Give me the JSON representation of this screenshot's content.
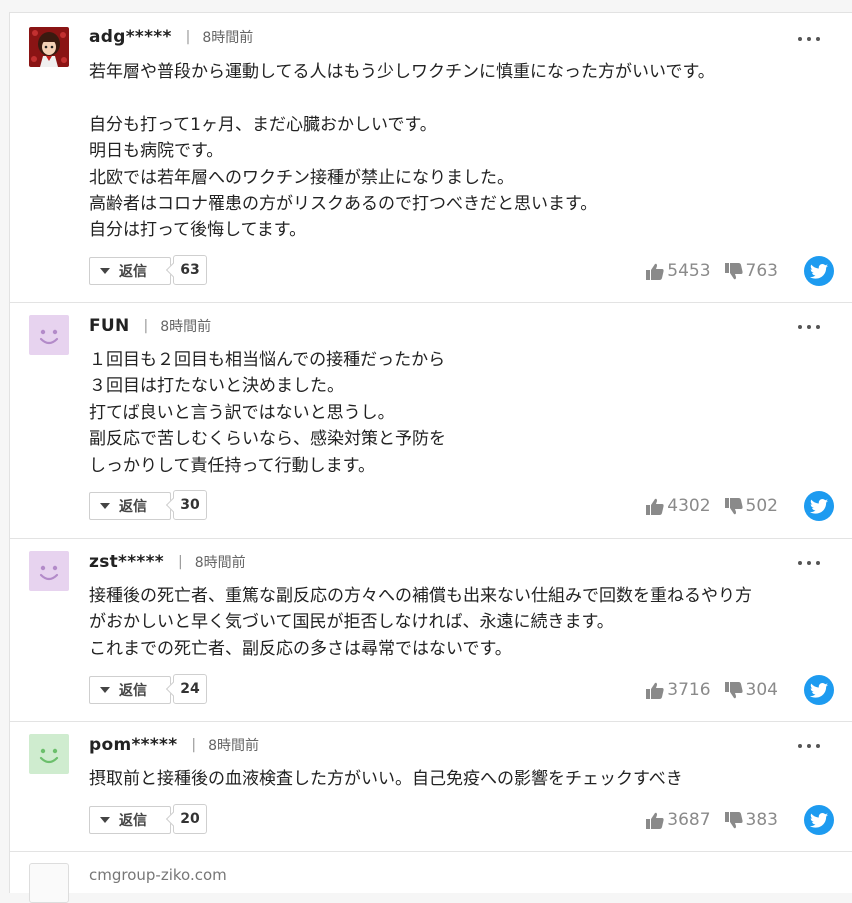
{
  "comments": [
    {
      "user": "adg*****",
      "separator": "|",
      "time": "8時間前",
      "avatar": "illustrated-avatar",
      "lines": [
        "若年層や普段から運動してる人はもう少しワクチンに慎重になった方がいいです。",
        "",
        "自分も打って1ヶ月、まだ心臓おかしいです。",
        "明日も病院です。",
        "北欧では若年層へのワクチン接種が禁止になりました。",
        "高齢者はコロナ罹患の方がリスクあるので打つべきだと思います。",
        "自分は打って後悔してます。"
      ],
      "reply_label": "返信",
      "reply_count": "63",
      "likes": "5453",
      "dislikes": "763"
    },
    {
      "user": "FUN",
      "separator": "|",
      "time": "8時間前",
      "avatar": "smiley-purple",
      "lines": [
        "１回目も２回目も相当悩んでの接種だったから",
        "３回目は打たないと決めました。",
        "打てば良いと言う訳ではないと思うし。",
        "副反応で苦しむくらいなら、感染対策と予防を",
        "しっかりして責任持って行動します。"
      ],
      "reply_label": "返信",
      "reply_count": "30",
      "likes": "4302",
      "dislikes": "502"
    },
    {
      "user": "zst*****",
      "separator": "|",
      "time": "8時間前",
      "avatar": "smiley-purple",
      "lines": [
        "接種後の死亡者、重篤な副反応の方々への補償も出来ない仕組みで回数を重ねるやり方",
        "がおかしいと早く気づいて国民が拒否しなければ、永遠に続きます。",
        "これまでの死亡者、副反応の多さは尋常ではないです。"
      ],
      "reply_label": "返信",
      "reply_count": "24",
      "likes": "3716",
      "dislikes": "304"
    },
    {
      "user": "pom*****",
      "separator": "|",
      "time": "8時間前",
      "avatar": "smiley-green",
      "lines": [
        "摂取前と接種後の血液検査した方がいい。自己免疫への影響をチェックすべき"
      ],
      "reply_label": "返信",
      "reply_count": "20",
      "likes": "3687",
      "dislikes": "383"
    }
  ],
  "next_comment": {
    "user": "cmgroup-ziko.com"
  },
  "colors": {
    "smiley_purple_bg": "#e7d3ef",
    "smiley_purple_fg": "#b38bc9",
    "smiley_green_bg": "#cfeccf",
    "smiley_green_fg": "#6cbf6c",
    "twitter_blue": "#1d9bf0"
  }
}
